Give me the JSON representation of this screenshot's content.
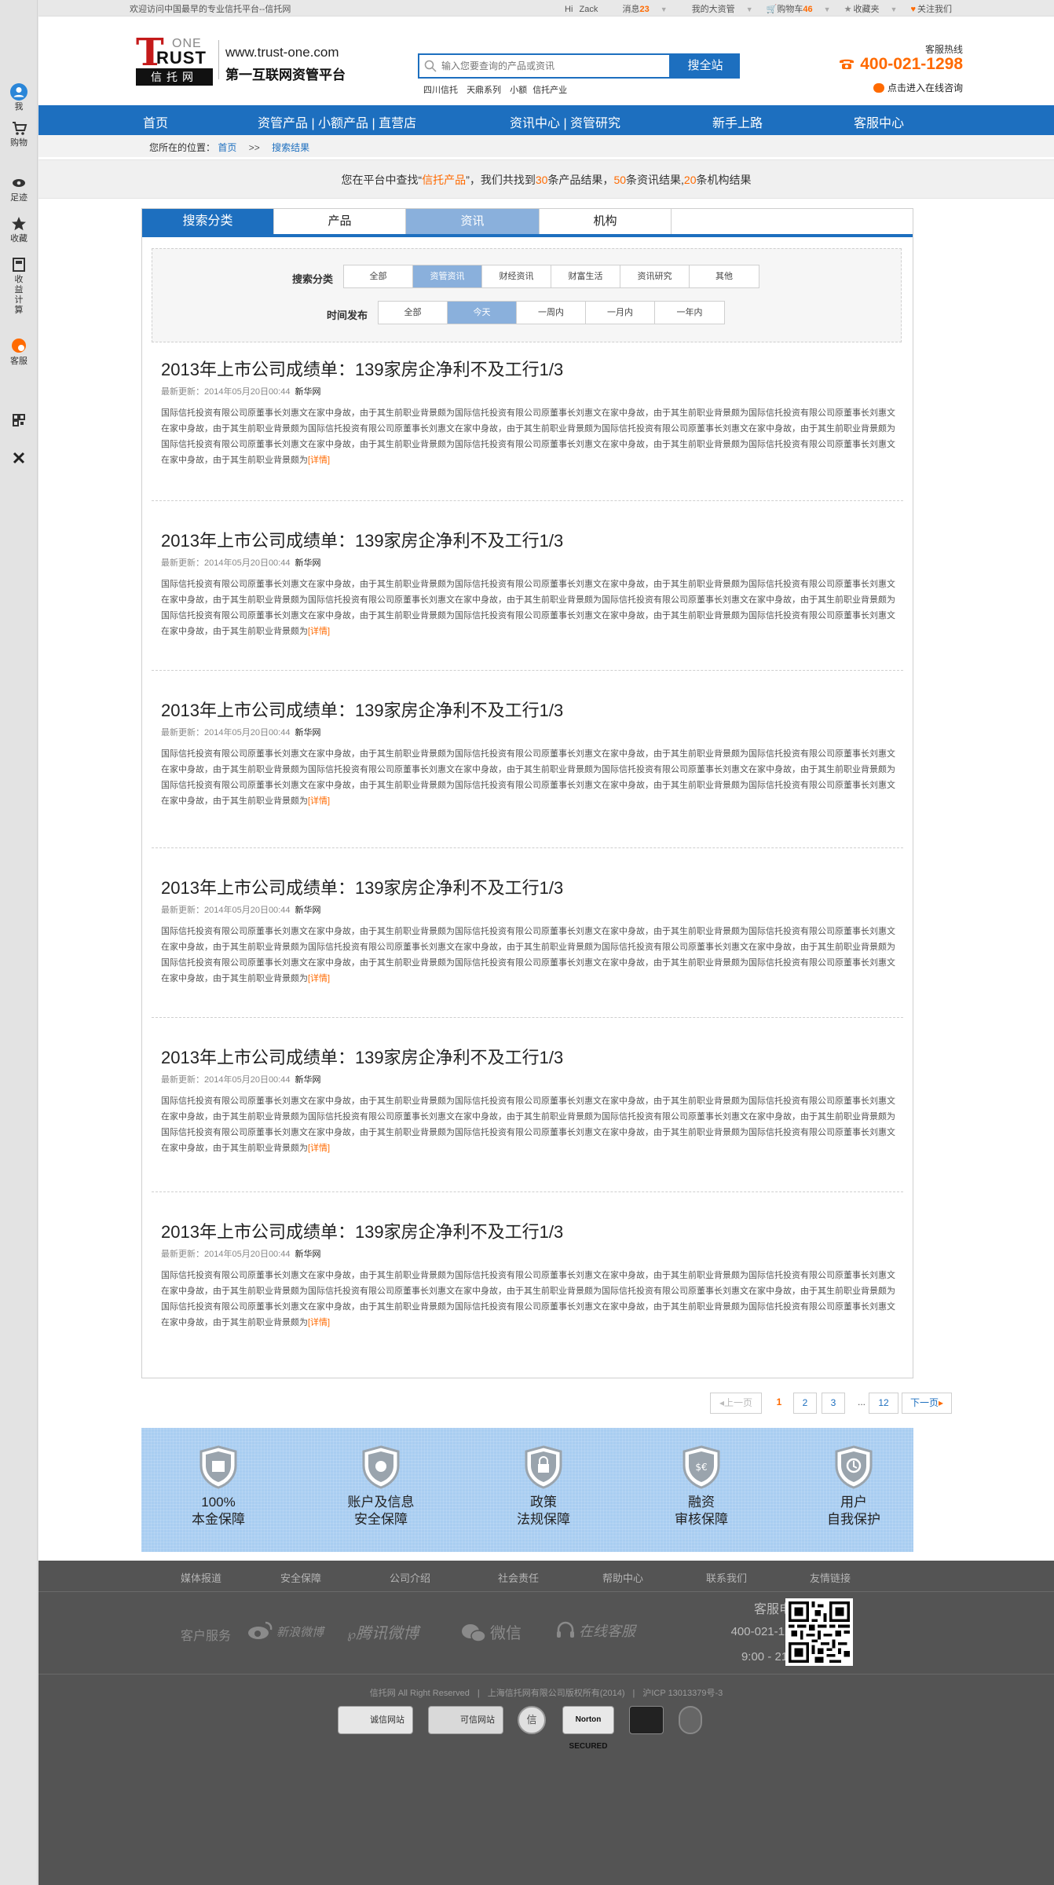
{
  "sidebar": {
    "items": [
      {
        "label": "我",
        "icon": "user-icon"
      },
      {
        "label": "购物",
        "icon": "cart-icon"
      },
      {
        "label": "足迹",
        "icon": "eye-icon"
      },
      {
        "label": "收藏",
        "icon": "star-icon"
      },
      {
        "label": "收益计算",
        "icon": "calculator-icon"
      },
      {
        "label": "客服",
        "icon": "chat-icon"
      },
      {
        "label": "",
        "icon": "qrcode-icon"
      },
      {
        "label": "",
        "icon": "close-icon"
      }
    ]
  },
  "topbar": {
    "welcome": "欢迎访问中国最早的专业信托平台--信托网",
    "hi": "Hi",
    "username": "Zack",
    "messages_label": "消息",
    "messages_count": "23",
    "my_assets": "我的大资管",
    "cart_label": "购物车",
    "cart_count": "46",
    "favorites": "收藏夹",
    "follow": "关注我们"
  },
  "header": {
    "logo_one": "ONE",
    "logo_rust": "RUST",
    "logo_cn": "信托网",
    "url": "www.trust-one.com",
    "slogan": "第一互联网资管平台",
    "search_placeholder": "输入您要查询的产品或资讯",
    "search_button": "搜全站",
    "hot_words": [
      "四川信托",
      "天鼎系列",
      "小额",
      "信托产业"
    ],
    "hotline_label": "客服热线",
    "hotline_number": "400-021-1298",
    "online_service": "点击进入在线咨询"
  },
  "nav": {
    "items": [
      "首页",
      "资管产品 | 小额产品 | 直营店",
      "资讯中心 | 资管研究",
      "新手上路",
      "客服中心"
    ]
  },
  "breadcrumb": {
    "prefix": "您所在的位置：",
    "home": "首页",
    "sep": ">>",
    "current": "搜索结果"
  },
  "summary": {
    "p1": "您在平台中查找“",
    "keyword": "信托产品",
    "p2": "”，我们共找到",
    "product_count": "30",
    "p3": "条产品结果，",
    "news_count": "50",
    "p4": "条资讯结果,",
    "org_count": "20",
    "p5": "条机构结果"
  },
  "tabs": [
    "搜索分类",
    "产品",
    "资讯",
    "机构"
  ],
  "filters": {
    "category_label": "搜索分类",
    "category_options": [
      "全部",
      "资管资讯",
      "财经资讯",
      "财富生活",
      "资讯研究",
      "其他"
    ],
    "time_label": "时间发布",
    "time_options": [
      "全部",
      "今天",
      "一周内",
      "一月内",
      "一年内"
    ]
  },
  "articles": [
    {
      "title": "2013年上市公司成绩单：139家房企净利不及工行1/3",
      "updated": "最新更新：2014年05月20日00:44",
      "source": "新华网",
      "body": "国际信托投资有限公司原董事长刘惠文在家中身故，由于其生前职业背景颇为国际信托投资有限公司原董事长刘惠文在家中身故，由于其生前职业背景颇为国际信托投资有限公司原董事长刘惠文在家中身故，由于其生前职业背景颇为国际信托投资有限公司原董事长刘惠文在家中身故，由于其生前职业背景颇为国际信托投资有限公司原董事长刘惠文在家中身故，由于其生前职业背景颇为国际信托投资有限公司原董事长刘惠文在家中身故，由于其生前职业背景颇为国际信托投资有限公司原董事长刘惠文在家中身故，由于其生前职业背景颇为国际信托投资有限公司原董事长刘惠文在家中身故，由于其生前职业背景颇为",
      "more": "[详情]"
    },
    {
      "title": "2013年上市公司成绩单：139家房企净利不及工行1/3",
      "updated": "最新更新：2014年05月20日00:44",
      "source": "新华网",
      "body": "国际信托投资有限公司原董事长刘惠文在家中身故，由于其生前职业背景颇为国际信托投资有限公司原董事长刘惠文在家中身故，由于其生前职业背景颇为国际信托投资有限公司原董事长刘惠文在家中身故，由于其生前职业背景颇为国际信托投资有限公司原董事长刘惠文在家中身故，由于其生前职业背景颇为国际信托投资有限公司原董事长刘惠文在家中身故，由于其生前职业背景颇为国际信托投资有限公司原董事长刘惠文在家中身故，由于其生前职业背景颇为国际信托投资有限公司原董事长刘惠文在家中身故，由于其生前职业背景颇为国际信托投资有限公司原董事长刘惠文在家中身故，由于其生前职业背景颇为",
      "more": "[详情]"
    },
    {
      "title": "2013年上市公司成绩单：139家房企净利不及工行1/3",
      "updated": "最新更新：2014年05月20日00:44",
      "source": "新华网",
      "body": "国际信托投资有限公司原董事长刘惠文在家中身故，由于其生前职业背景颇为国际信托投资有限公司原董事长刘惠文在家中身故，由于其生前职业背景颇为国际信托投资有限公司原董事长刘惠文在家中身故，由于其生前职业背景颇为国际信托投资有限公司原董事长刘惠文在家中身故，由于其生前职业背景颇为国际信托投资有限公司原董事长刘惠文在家中身故，由于其生前职业背景颇为国际信托投资有限公司原董事长刘惠文在家中身故，由于其生前职业背景颇为国际信托投资有限公司原董事长刘惠文在家中身故，由于其生前职业背景颇为国际信托投资有限公司原董事长刘惠文在家中身故，由于其生前职业背景颇为",
      "more": "[详情]"
    },
    {
      "title": "2013年上市公司成绩单：139家房企净利不及工行1/3",
      "updated": "最新更新：2014年05月20日00:44",
      "source": "新华网",
      "body": "国际信托投资有限公司原董事长刘惠文在家中身故，由于其生前职业背景颇为国际信托投资有限公司原董事长刘惠文在家中身故，由于其生前职业背景颇为国际信托投资有限公司原董事长刘惠文在家中身故，由于其生前职业背景颇为国际信托投资有限公司原董事长刘惠文在家中身故，由于其生前职业背景颇为国际信托投资有限公司原董事长刘惠文在家中身故，由于其生前职业背景颇为国际信托投资有限公司原董事长刘惠文在家中身故，由于其生前职业背景颇为国际信托投资有限公司原董事长刘惠文在家中身故，由于其生前职业背景颇为国际信托投资有限公司原董事长刘惠文在家中身故，由于其生前职业背景颇为",
      "more": "[详情]"
    },
    {
      "title": "2013年上市公司成绩单：139家房企净利不及工行1/3",
      "updated": "最新更新：2014年05月20日00:44",
      "source": "新华网",
      "body": "国际信托投资有限公司原董事长刘惠文在家中身故，由于其生前职业背景颇为国际信托投资有限公司原董事长刘惠文在家中身故，由于其生前职业背景颇为国际信托投资有限公司原董事长刘惠文在家中身故，由于其生前职业背景颇为国际信托投资有限公司原董事长刘惠文在家中身故，由于其生前职业背景颇为国际信托投资有限公司原董事长刘惠文在家中身故，由于其生前职业背景颇为国际信托投资有限公司原董事长刘惠文在家中身故，由于其生前职业背景颇为国际信托投资有限公司原董事长刘惠文在家中身故，由于其生前职业背景颇为国际信托投资有限公司原董事长刘惠文在家中身故，由于其生前职业背景颇为",
      "more": "[详情]"
    },
    {
      "title": "2013年上市公司成绩单：139家房企净利不及工行1/3",
      "updated": "最新更新：2014年05月20日00:44",
      "source": "新华网",
      "body": "国际信托投资有限公司原董事长刘惠文在家中身故，由于其生前职业背景颇为国际信托投资有限公司原董事长刘惠文在家中身故，由于其生前职业背景颇为国际信托投资有限公司原董事长刘惠文在家中身故，由于其生前职业背景颇为国际信托投资有限公司原董事长刘惠文在家中身故，由于其生前职业背景颇为国际信托投资有限公司原董事长刘惠文在家中身故，由于其生前职业背景颇为国际信托投资有限公司原董事长刘惠文在家中身故，由于其生前职业背景颇为国际信托投资有限公司原董事长刘惠文在家中身故，由于其生前职业背景颇为国际信托投资有限公司原董事长刘惠文在家中身故，由于其生前职业背景颇为",
      "more": "[详情]"
    }
  ],
  "pagination": {
    "prev": "上一页",
    "pages": [
      "1",
      "2",
      "3"
    ],
    "ellipsis": "...",
    "last": "12",
    "next": "下一页",
    "current": "1"
  },
  "guarantees": [
    {
      "line1": "100%",
      "line2": "本金保障",
      "icon": "principal-shield-icon"
    },
    {
      "line1": "账户及信息",
      "line2": "安全保障",
      "icon": "money-bag-shield-icon"
    },
    {
      "line1": "政策",
      "line2": "法规保障",
      "icon": "lock-shield-icon"
    },
    {
      "line1": "融资",
      "line2": "审核保障",
      "icon": "currency-shield-icon"
    },
    {
      "line1": "用户",
      "line2": "自我保护",
      "icon": "user-shield-icon"
    }
  ],
  "footer": {
    "links": [
      "媒体报道",
      "安全保障",
      "公司介绍",
      "社会责任",
      "帮助中心",
      "联系我们",
      "友情链接"
    ],
    "service_label": "客户服务",
    "social": [
      "新浪微博",
      "腾讯微博",
      "微信",
      "在线客服"
    ],
    "hotline_label": "客服电话",
    "hotline_number": "400-021-1298",
    "hours": "9:00 - 21:00",
    "copyright": [
      "信托网 All Right Reserved",
      "上海信托网有限公司版权所有(2014)",
      "沪ICP 13013379号-3"
    ],
    "badges": [
      "诚信网站",
      "可信网站",
      "信",
      "Norton SECURED",
      "",
      ""
    ]
  },
  "colors": {
    "brand_blue": "#1d6fbf",
    "accent_orange": "#ff6a00",
    "active_tab": "#8ab0dc",
    "footer_bg": "#545454"
  }
}
